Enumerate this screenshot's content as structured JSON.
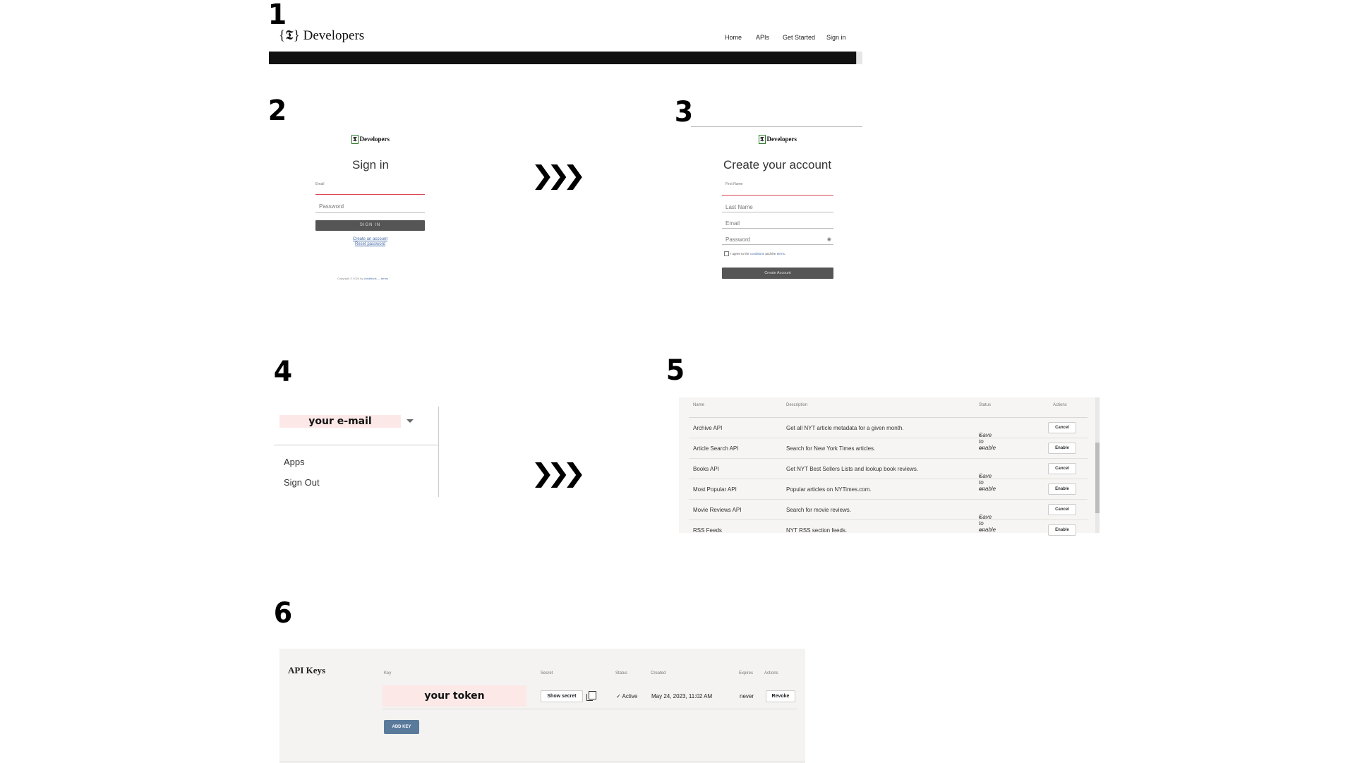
{
  "steps": [
    "1",
    "2",
    "3",
    "4",
    "5",
    "6"
  ],
  "panel1": {
    "logo_glyph": "{𝕿}",
    "logo_text": "Developers",
    "nav": [
      "Home",
      "APIs",
      "Get Started",
      "Sign in"
    ]
  },
  "panel2": {
    "logo_text": "Developers",
    "title": "Sign in",
    "email_label": "Email",
    "password_placeholder": "Password",
    "signin_button": "SIGN IN",
    "create_account_link": "Create an account",
    "reset_password_link": "Reset password",
    "copyright": "Copyright © 2024 by",
    "conditions": "conditions",
    "terms": "terms"
  },
  "panel3": {
    "logo_text": "Developers",
    "title": "Create your account",
    "first_name": "First Name",
    "last_name": "Last Name",
    "email": "Email",
    "password": "Password",
    "agree_prefix": "I agree to the",
    "agree_conditions": "conditions",
    "agree_and": "and the",
    "agree_terms": "terms",
    "create_button": "Create Account"
  },
  "panel4": {
    "email": "your e-mail",
    "menu": [
      "Apps",
      "Sign Out"
    ]
  },
  "panel5": {
    "headers": [
      "Name",
      "Description",
      "Status",
      "Actions"
    ],
    "rows": [
      {
        "name": "Archive API",
        "description": "Get all NYT article metadata for a given month.",
        "status": "Save to enable",
        "action": "Cancel"
      },
      {
        "name": "Article Search API",
        "description": "Search for New York Times articles.",
        "status": "—",
        "action": "Enable"
      },
      {
        "name": "Books API",
        "description": "Get NYT Best Sellers Lists and lookup book reviews.",
        "status": "Save to enable",
        "action": "Cancel"
      },
      {
        "name": "Most Popular API",
        "description": "Popular articles on NYTimes.com.",
        "status": "—",
        "action": "Enable"
      },
      {
        "name": "Movie Reviews API",
        "description": "Search for movie reviews.",
        "status": "Save to enable",
        "action": "Cancel"
      },
      {
        "name": "RSS Feeds",
        "description": "NYT RSS section feeds.",
        "status": "—",
        "action": "Enable"
      }
    ]
  },
  "panel6": {
    "title": "API Keys",
    "headers": [
      "Key",
      "Secret",
      "Status",
      "Created",
      "Expires",
      "Actions"
    ],
    "token": "your token",
    "show_secret": "Show secret",
    "status": "✓ Active",
    "created": "May 24, 2023, 11:02 AM",
    "expires": "never",
    "revoke": "Revoke",
    "add_key": "ADD KEY"
  },
  "colors": {
    "highlight": "#fde8e8",
    "button_dark": "#555555",
    "add_key": "#5a7a9c",
    "link": "#4a6ea8"
  }
}
